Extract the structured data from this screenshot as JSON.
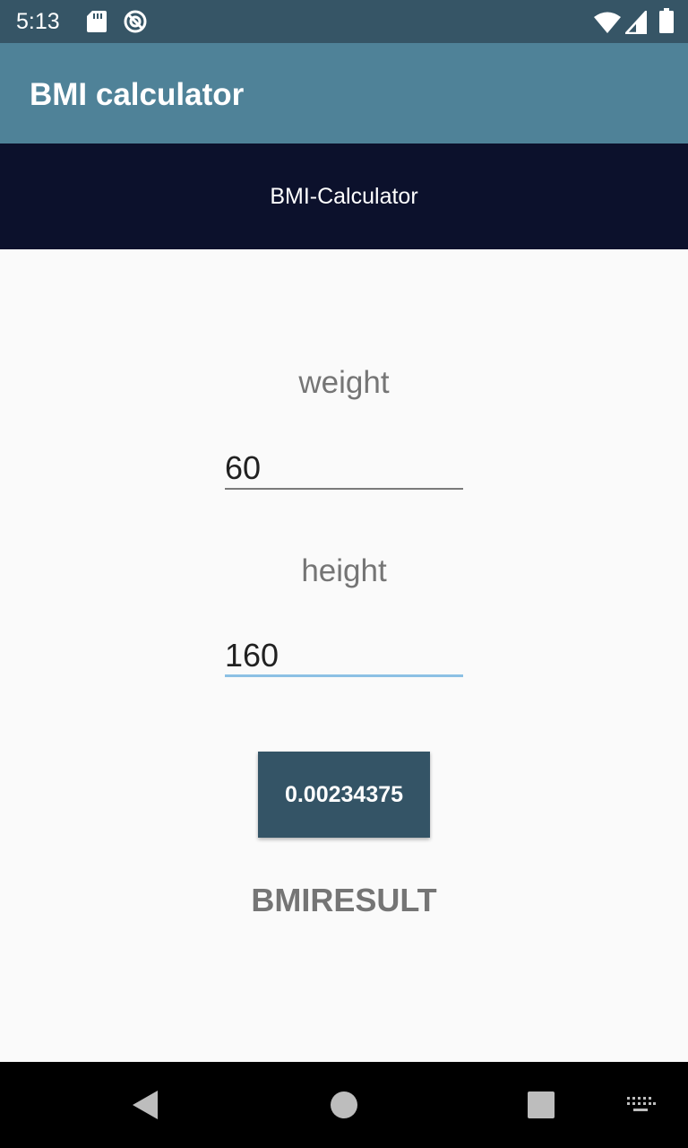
{
  "status_bar": {
    "time": "5:13",
    "icons": [
      "sd-card-icon",
      "do-not-disturb-icon",
      "wifi-icon",
      "signal-icon",
      "battery-icon"
    ]
  },
  "app_bar": {
    "title": "BMI calculator"
  },
  "header": {
    "text": "BMI-Calculator"
  },
  "form": {
    "weight_label": "weight",
    "weight_value": "60",
    "height_label": "height",
    "height_value": "160",
    "result_button_label": "0.00234375",
    "result_label": "BMIRESULT"
  },
  "nav_bar": {
    "icons": [
      "back-icon",
      "home-icon",
      "recents-icon",
      "keyboard-icon"
    ]
  },
  "colors": {
    "status_bar": "#365566",
    "app_bar": "#4f8298",
    "header_band": "#0c112c",
    "button": "#345466",
    "focused_underline": "#8cc0e4"
  }
}
